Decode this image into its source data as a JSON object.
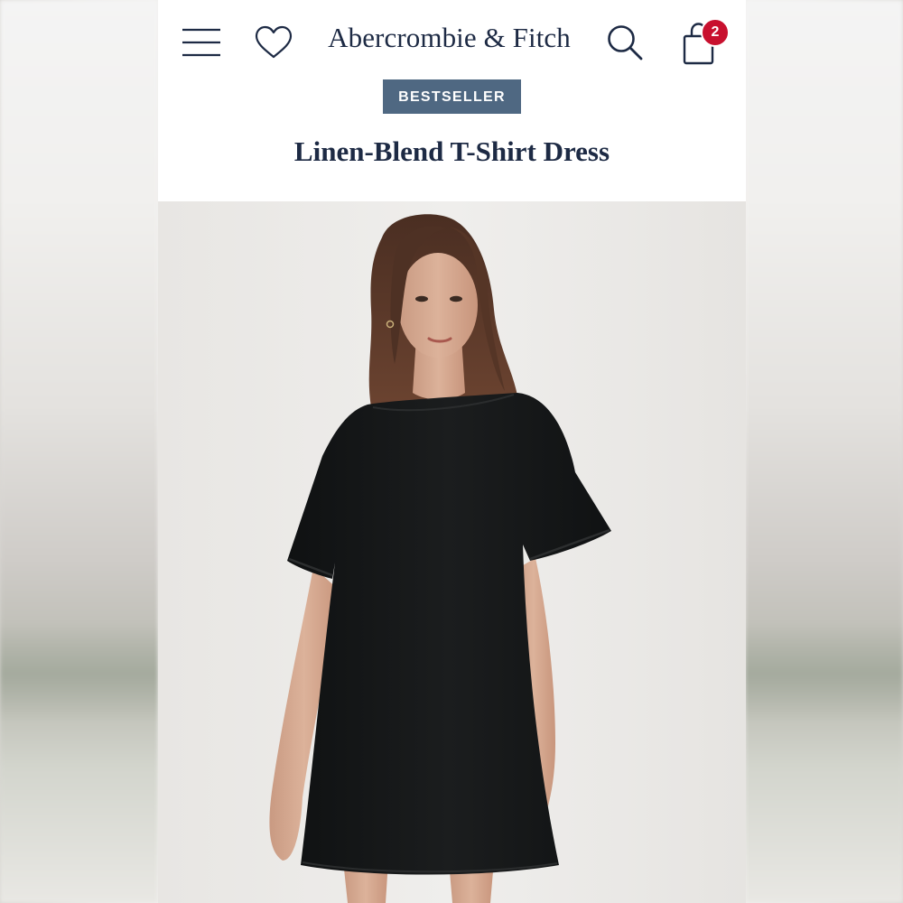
{
  "header": {
    "brand": "Abercrombie & Fitch",
    "cart_count": "2",
    "icons": {
      "menu": "hamburger-menu-icon",
      "wishlist": "heart-icon",
      "search": "search-icon",
      "bag": "shopping-bag-icon"
    }
  },
  "product": {
    "badge": "BESTSELLER",
    "title": "Linen-Blend T-Shirt Dress",
    "image_alt": "Model wearing black short-sleeve t-shirt dress"
  },
  "colors": {
    "brand_navy": "#1d2a44",
    "badge_bg": "#4f6882",
    "cart_badge": "#c8102e",
    "dress": "#141617"
  }
}
